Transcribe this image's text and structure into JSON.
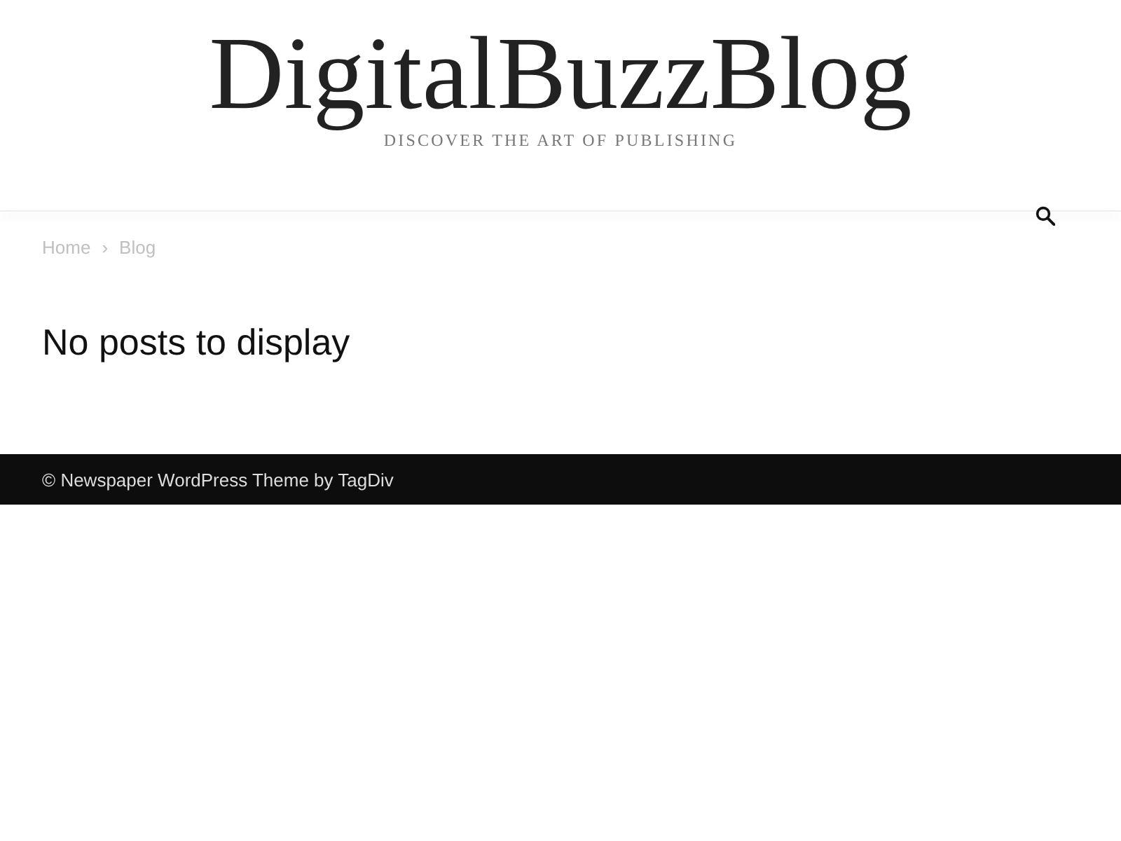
{
  "header": {
    "logo": "DigitalBuzzBlog",
    "tagline": "DISCOVER THE ART OF PUBLISHING"
  },
  "breadcrumbs": {
    "items": [
      {
        "label": "Home"
      },
      {
        "label": "Blog"
      }
    ],
    "separator": "›"
  },
  "content": {
    "heading": "No posts to display"
  },
  "footer": {
    "copyright": "© Newspaper WordPress Theme by TagDiv"
  }
}
